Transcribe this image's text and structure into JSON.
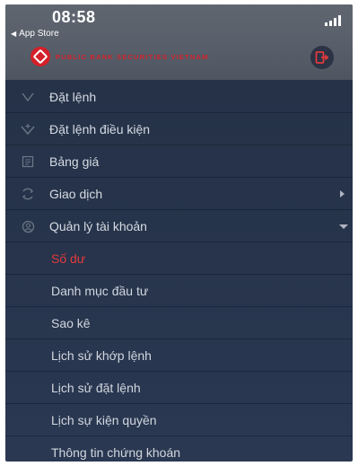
{
  "status_bar": {
    "time": "08:58",
    "back_label": "App Store"
  },
  "header": {
    "brand_name": "PUBLIC BANK SECURITIES VIETNAM",
    "brand_color": "#d4202a"
  },
  "menu": {
    "items": [
      {
        "label": "Đặt lệnh",
        "icon": "order-icon"
      },
      {
        "label": "Đặt lệnh điều kiện",
        "icon": "conditional-order-icon"
      },
      {
        "label": "Bảng giá",
        "icon": "price-board-icon"
      },
      {
        "label": "Giao dịch",
        "icon": "transaction-icon",
        "caret": "right"
      },
      {
        "label": "Quản lý tài khoản",
        "icon": "account-icon",
        "caret": "down",
        "expanded": true
      }
    ],
    "sub_items": [
      {
        "label": "Số dư",
        "active": true
      },
      {
        "label": "Danh mục đầu tư"
      },
      {
        "label": "Sao kê"
      },
      {
        "label": "Lịch sử khớp lệnh"
      },
      {
        "label": "Lịch sử đặt lệnh"
      },
      {
        "label": "Lịch sự kiện quyền"
      },
      {
        "label": "Thông tin chứng khoán"
      }
    ],
    "active_color": "#e33a3a"
  }
}
